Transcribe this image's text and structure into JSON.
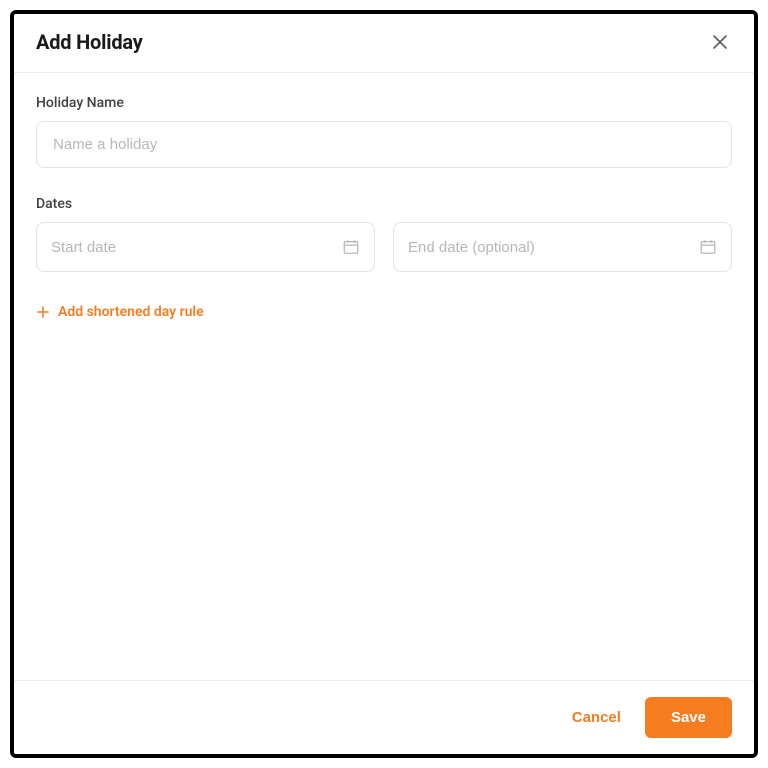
{
  "modal": {
    "title": "Add Holiday"
  },
  "fields": {
    "holiday_name": {
      "label": "Holiday Name",
      "placeholder": "Name a holiday",
      "value": ""
    },
    "dates": {
      "label": "Dates",
      "start": {
        "placeholder": "Start date",
        "value": ""
      },
      "end": {
        "placeholder": "End date (optional)",
        "value": ""
      }
    }
  },
  "actions": {
    "add_rule": "Add shortened day rule",
    "cancel": "Cancel",
    "save": "Save"
  },
  "colors": {
    "accent": "#f57c1f",
    "border": "#e3e3e3",
    "placeholder": "#b7b7b7"
  }
}
